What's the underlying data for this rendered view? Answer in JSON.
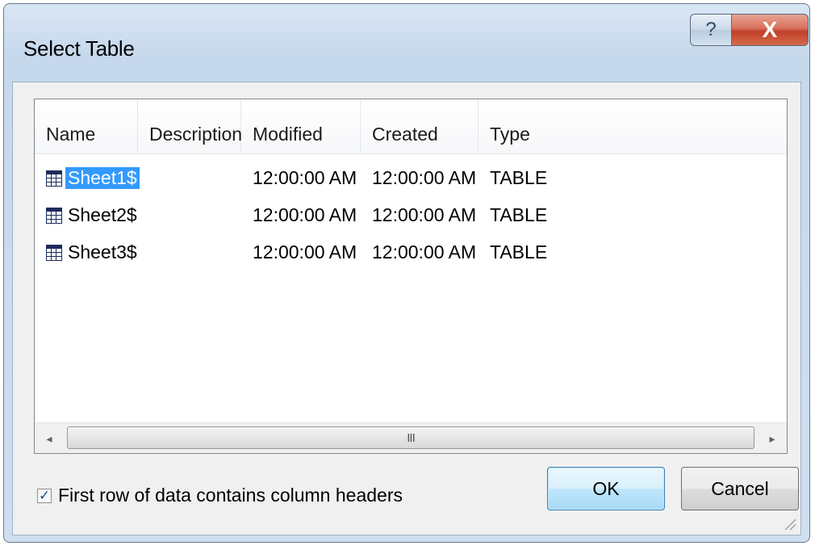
{
  "window": {
    "title": "Select Table",
    "help_glyph": "?",
    "close_glyph": "X"
  },
  "listview": {
    "columns": [
      "Name",
      "Description",
      "Modified",
      "Created",
      "Type"
    ],
    "rows": [
      {
        "name": "Sheet1$",
        "description": "",
        "modified": "12:00:00 AM",
        "created": "12:00:00 AM",
        "type": "TABLE",
        "selected": true
      },
      {
        "name": "Sheet2$",
        "description": "",
        "modified": "12:00:00 AM",
        "created": "12:00:00 AM",
        "type": "TABLE",
        "selected": false
      },
      {
        "name": "Sheet3$",
        "description": "",
        "modified": "12:00:00 AM",
        "created": "12:00:00 AM",
        "type": "TABLE",
        "selected": false
      }
    ],
    "scrollbar": {
      "left_arrow": "◂",
      "right_arrow": "▸",
      "thumb_grip": "III"
    }
  },
  "options": {
    "first_row_headers_label": "First row of data contains column headers",
    "first_row_headers_checked": true,
    "check_glyph": "✓"
  },
  "buttons": {
    "ok_label": "OK",
    "cancel_label": "Cancel"
  },
  "colors": {
    "selection": "#3399ff",
    "close_button": "#c0402a",
    "default_button_border": "#3c7fb1"
  },
  "icons": {
    "row_icon": "table-icon",
    "help": "help-icon",
    "close": "close-icon"
  }
}
